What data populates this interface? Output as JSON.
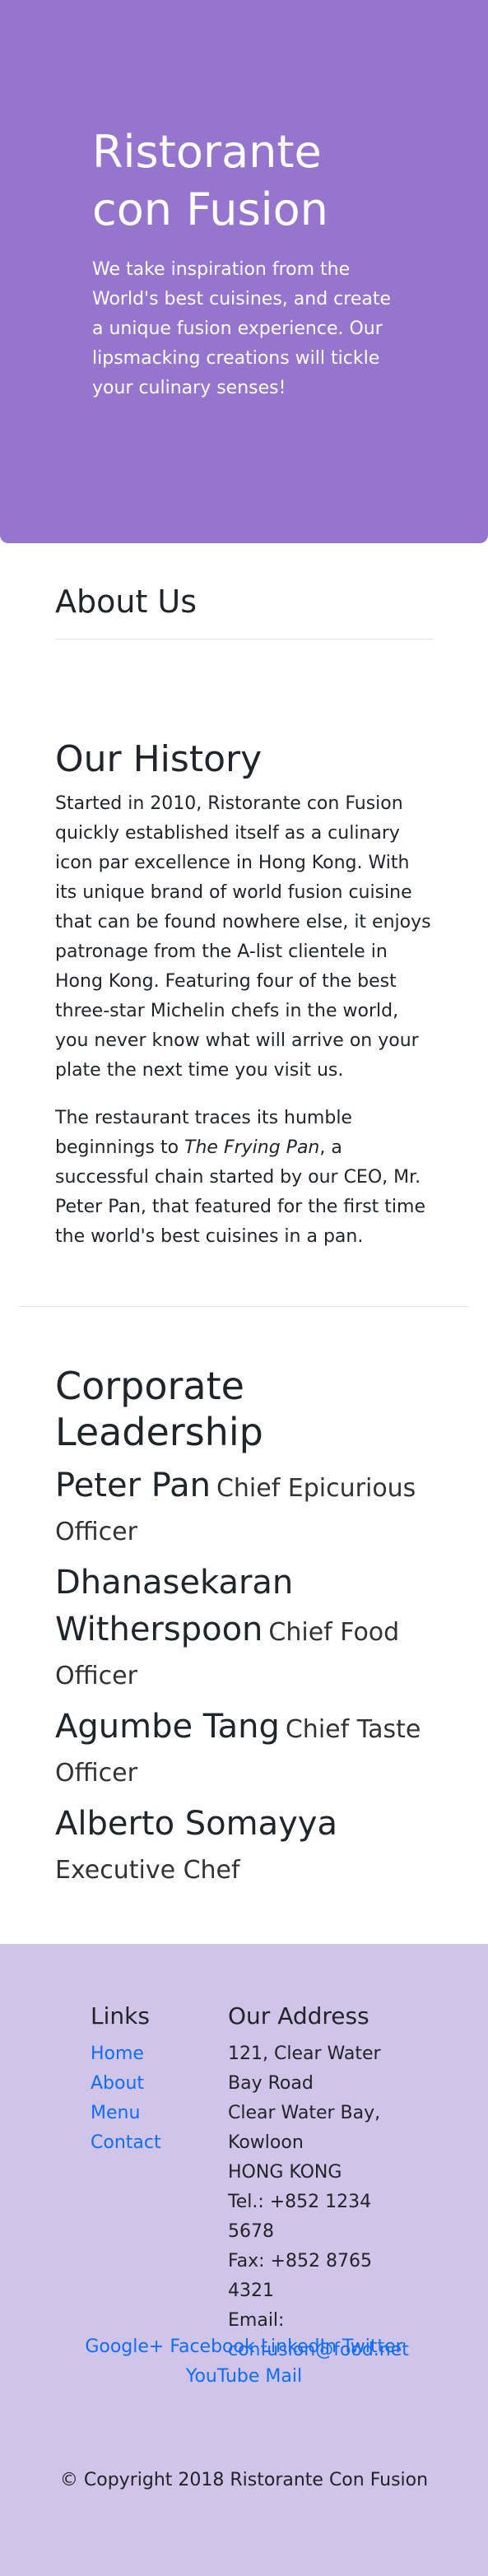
{
  "jumbotron": {
    "title": "Ristorante con Fusion",
    "text": "We take inspiration from the World's best cuisines, and create a unique fusion experience. Our lipsmacking creations will tickle your culinary senses!"
  },
  "about": {
    "title": "About Us"
  },
  "history": {
    "title": "Our History",
    "p1": "Started in 2010, Ristorante con Fusion quickly established itself as a culinary icon par excellence in Hong Kong. With its unique brand of world fusion cuisine that can be found nowhere else, it enjoys patronage from the A-list clientele in Hong Kong. Featuring four of the best three-star Michelin chefs in the world, you never know what will arrive on your plate the next time you visit us.",
    "p2_before": "The restaurant traces its humble beginnings to ",
    "p2_italic": "The Frying Pan",
    "p2_after": ", a successful chain started by our CEO, Mr. Peter Pan, that featured for the first time the world's best cuisines in a pan."
  },
  "leadership": {
    "title": "Corporate Leadership",
    "leaders": [
      {
        "name": "Peter Pan",
        "role": "Chief Epicurious Officer"
      },
      {
        "name": "Dhanasekaran Witherspoon",
        "role": "Chief Food Officer"
      },
      {
        "name": "Agumbe Tang",
        "role": "Chief Taste Officer"
      },
      {
        "name": "Alberto Somayya",
        "role": "Executive Chef"
      }
    ]
  },
  "footer": {
    "links_title": "Links",
    "links": [
      "Home",
      "About",
      "Menu",
      "Contact"
    ],
    "address_title": "Our Address",
    "address": [
      "121, Clear Water Bay Road",
      "Clear Water Bay, Kowloon",
      "HONG KONG",
      "Tel.: +852 1234 5678",
      "Fax: +852 8765 4321"
    ],
    "email_label": "Email:",
    "email": "confusion@food.net",
    "social": [
      "Google+",
      "Facebook",
      "LinkedIn",
      "Twitter",
      "YouTube",
      "Mail"
    ],
    "copyright": "© Copyright 2018 Ristorante Con Fusion"
  },
  "colors": {
    "jumbotron": "#9575cd",
    "footer": "#d1c4e9",
    "link": "#0d6efd"
  }
}
